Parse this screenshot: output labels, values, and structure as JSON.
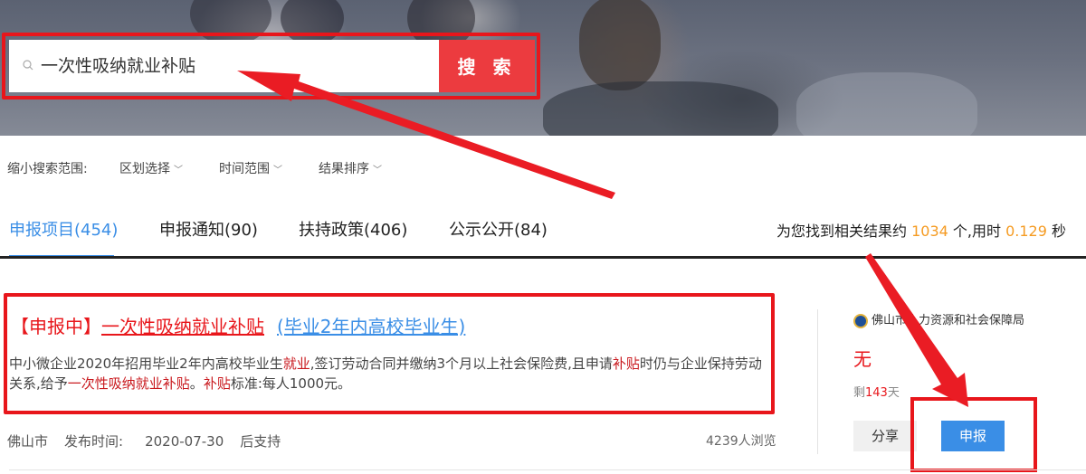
{
  "search": {
    "value": "一次性吸纳就业补贴",
    "button_label": "搜 索"
  },
  "filters": {
    "label": "缩小搜索范围:",
    "items": [
      {
        "label": "区划选择"
      },
      {
        "label": "时间范围"
      },
      {
        "label": "结果排序"
      }
    ]
  },
  "tabs": [
    {
      "label": "申报项目(454)",
      "active": true
    },
    {
      "label": "申报通知(90)"
    },
    {
      "label": "扶持政策(406)"
    },
    {
      "label": "公示公开(84)"
    }
  ],
  "summary": {
    "prefix": "为您找到相关结果约",
    "count": "1034",
    "mid": "个,用时",
    "time": "0.129",
    "suffix": "秒"
  },
  "result": {
    "status": "【申报中】",
    "title": "一次性吸纳就业补贴",
    "subtitle": "(毕业2年内高校毕业生)",
    "desc": {
      "p1": "中小微企业2020年招用毕业2年内高校毕业生",
      "h1": "就业",
      "p2": ",签订劳动合同并缴纳3个月以上社会保险费,且申请",
      "h2": "补贴",
      "p3": "时仍与企业保持劳动关系,给予",
      "h3": "一次性吸纳就业补贴",
      "p4": "。",
      "h4": "补贴",
      "p5": "标准:每人1000元。"
    },
    "region": "佛山市",
    "publish_label": "发布时间:",
    "publish_date": "2020-07-30",
    "support": "后支持",
    "views": "4239人浏览",
    "agency": "佛山市人力资源和社会保障局",
    "amount": "无",
    "remaining_prefix": "剩",
    "remaining_days": "143",
    "remaining_suffix": "天",
    "share_label": "分享",
    "apply_label": "申报"
  },
  "colors": {
    "accent_blue": "#3a8ee6",
    "brand_red": "#e8161b",
    "orange": "#f59b22"
  }
}
